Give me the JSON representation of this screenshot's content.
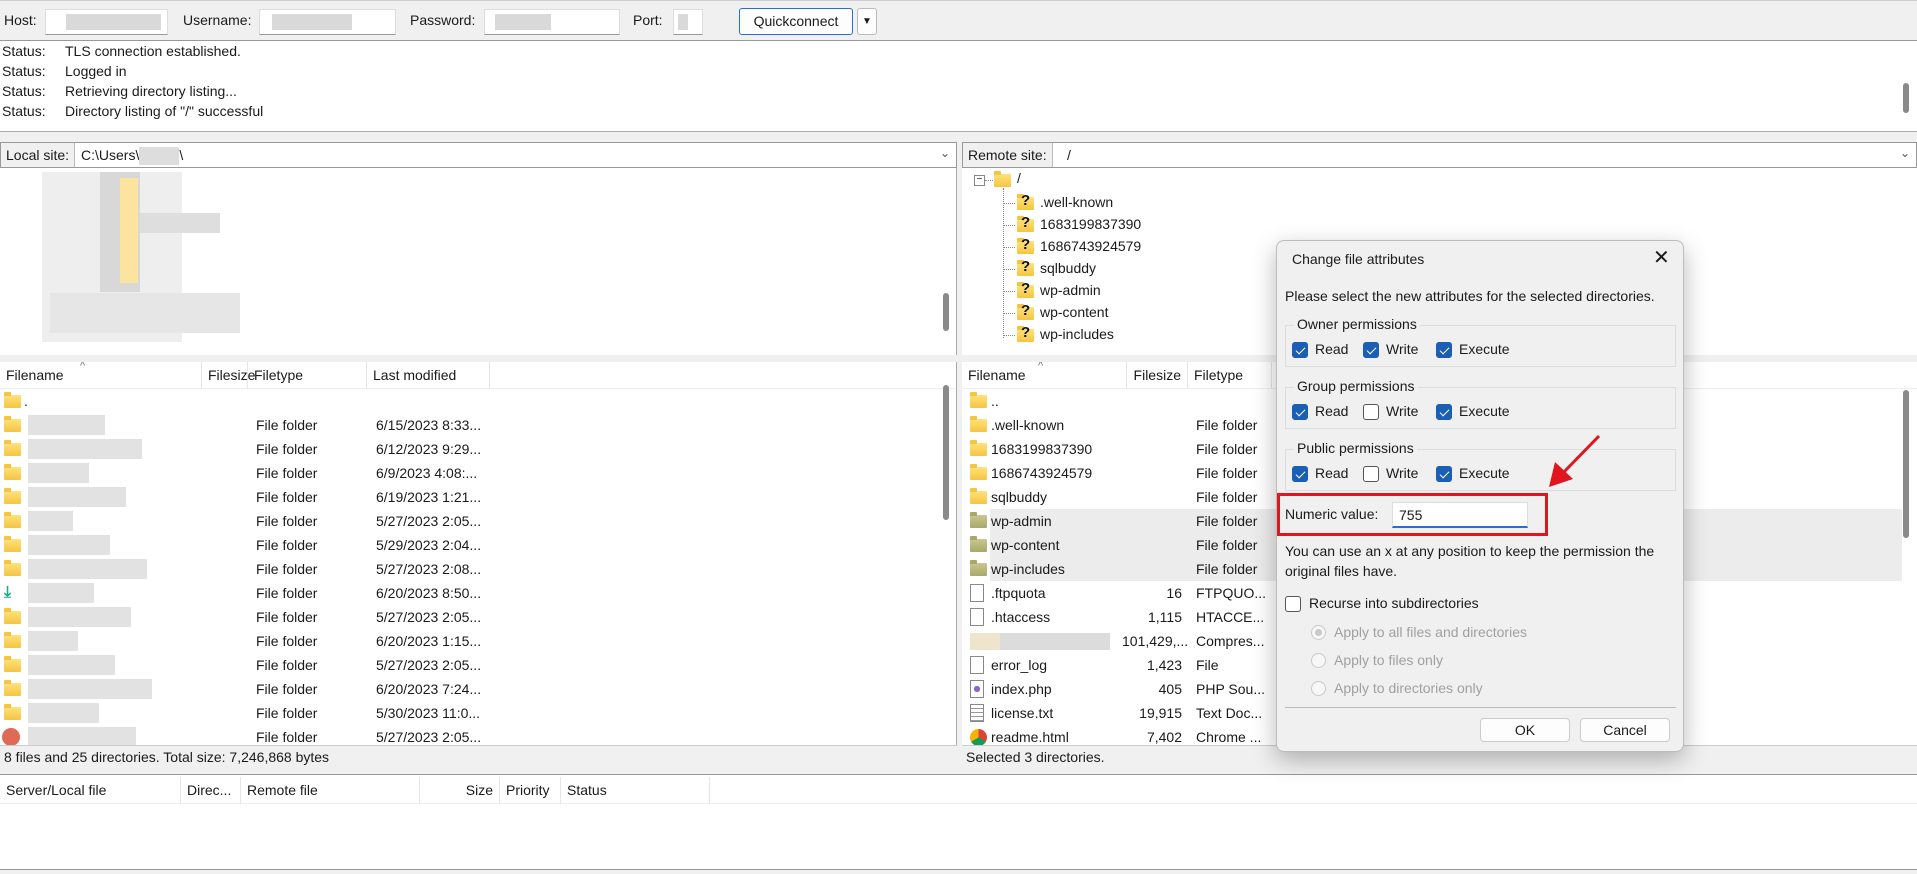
{
  "toolbar": {
    "host_label": "Host:",
    "username_label": "Username:",
    "password_label": "Password:",
    "port_label": "Port:",
    "quickconnect_label": "Quickconnect",
    "dropdown_icon": "triangle-down-icon"
  },
  "log": [
    {
      "key": "Status:",
      "text": "TLS connection established."
    },
    {
      "key": "Status:",
      "text": "Logged in"
    },
    {
      "key": "Status:",
      "text": "Retrieving directory listing..."
    },
    {
      "key": "Status:",
      "text": "Directory listing of \"/\" successful"
    }
  ],
  "local": {
    "site_label": "Local site:",
    "path_prefix": "C:\\Users\\",
    "path_suffix": "\\",
    "columns": [
      "Filename",
      "Filesize",
      "Filetype",
      "Last modified"
    ],
    "rows": [
      {
        "icon": "folder",
        "name": ".",
        "type": "",
        "modified": ""
      },
      {
        "icon": "folder",
        "type": "File folder",
        "modified": "6/15/2023 8:33..."
      },
      {
        "icon": "folder",
        "type": "File folder",
        "modified": "6/12/2023 9:29..."
      },
      {
        "icon": "folder",
        "type": "File folder",
        "modified": "6/9/2023 4:08:..."
      },
      {
        "icon": "folder",
        "type": "File folder",
        "modified": "6/19/2023 1:21..."
      },
      {
        "icon": "folder",
        "type": "File folder",
        "modified": "5/27/2023 2:05..."
      },
      {
        "icon": "folder",
        "type": "File folder",
        "modified": "5/29/2023 2:04..."
      },
      {
        "icon": "folder",
        "type": "File folder",
        "modified": "5/27/2023 2:08..."
      },
      {
        "icon": "download",
        "type": "File folder",
        "modified": "6/20/2023 8:50..."
      },
      {
        "icon": "folder",
        "type": "File folder",
        "modified": "5/27/2023 2:05..."
      },
      {
        "icon": "folder",
        "type": "File folder",
        "modified": "6/20/2023 1:15..."
      },
      {
        "icon": "folder",
        "type": "File folder",
        "modified": "5/27/2023 2:05..."
      },
      {
        "icon": "folder",
        "type": "File folder",
        "modified": "6/20/2023 7:24..."
      },
      {
        "icon": "folder",
        "type": "File folder",
        "modified": "5/30/2023 11:0..."
      },
      {
        "icon": "music",
        "type": "File folder",
        "modified": "5/27/2023 2:05..."
      }
    ],
    "status": "8 files and 25 directories. Total size: 7,246,868 bytes"
  },
  "remote": {
    "site_label": "Remote site:",
    "path": "/",
    "tree_root": "/",
    "tree": [
      ".well-known",
      "1683199837390",
      "1686743924579",
      "sqlbuddy",
      "wp-admin",
      "wp-content",
      "wp-includes"
    ],
    "columns": [
      "Filename",
      "Filesize",
      "Filetype"
    ],
    "rows": [
      {
        "icon": "folder",
        "name": "..",
        "size": "",
        "type": ""
      },
      {
        "icon": "folder",
        "name": ".well-known",
        "size": "",
        "type": "File folder"
      },
      {
        "icon": "folder",
        "name": "1683199837390",
        "size": "",
        "type": "File folder"
      },
      {
        "icon": "folder",
        "name": "1686743924579",
        "size": "",
        "type": "File folder"
      },
      {
        "icon": "folder",
        "name": "sqlbuddy",
        "size": "",
        "type": "File folder"
      },
      {
        "icon": "folder-selected",
        "name": "wp-admin",
        "size": "",
        "type": "File folder",
        "selected": true
      },
      {
        "icon": "folder-selected",
        "name": "wp-content",
        "size": "",
        "type": "File folder",
        "selected": true
      },
      {
        "icon": "folder-selected",
        "name": "wp-includes",
        "size": "",
        "type": "File folder",
        "selected": true
      },
      {
        "icon": "file",
        "name": ".ftpquota",
        "size": "16",
        "type": "FTPQUO..."
      },
      {
        "icon": "file",
        "name": ".htaccess",
        "size": "1,115",
        "type": "HTACCE..."
      },
      {
        "icon": "zip",
        "name": "",
        "size": "101,429,...",
        "type": "Compres..."
      },
      {
        "icon": "file",
        "name": "error_log",
        "size": "1,423",
        "type": "File"
      },
      {
        "icon": "php",
        "name": "index.php",
        "size": "405",
        "type": "PHP Sou..."
      },
      {
        "icon": "text",
        "name": "license.txt",
        "size": "19,915",
        "type": "Text Doc..."
      },
      {
        "icon": "chrome",
        "name": "readme.html",
        "size": "7,402",
        "type": "Chrome ..."
      }
    ],
    "status": "Selected 3 directories."
  },
  "queue": {
    "columns": [
      "Server/Local file",
      "Direc...",
      "Remote file",
      "Size",
      "Priority",
      "Status"
    ]
  },
  "dialog": {
    "title": "Change file attributes",
    "close_icon": "close-icon",
    "instruction": "Please select the new attributes for the selected directories.",
    "groups": [
      {
        "label": "Owner permissions",
        "read": true,
        "write": true,
        "execute": true
      },
      {
        "label": "Group permissions",
        "read": true,
        "write": false,
        "execute": true
      },
      {
        "label": "Public permissions",
        "read": true,
        "write": false,
        "execute": true
      }
    ],
    "perm_labels": {
      "read": "Read",
      "write": "Write",
      "execute": "Execute"
    },
    "numeric_label": "Numeric value:",
    "numeric_value": "755",
    "hint": "You can use an x at any position to keep the permission the original files have.",
    "recurse_label": "Recurse into subdirectories",
    "recurse": false,
    "apply_options": [
      "Apply to all files and directories",
      "Apply to files only",
      "Apply to directories only"
    ],
    "apply_selected": 0,
    "ok_label": "OK",
    "cancel_label": "Cancel",
    "highlight_color": "#e0161e"
  }
}
